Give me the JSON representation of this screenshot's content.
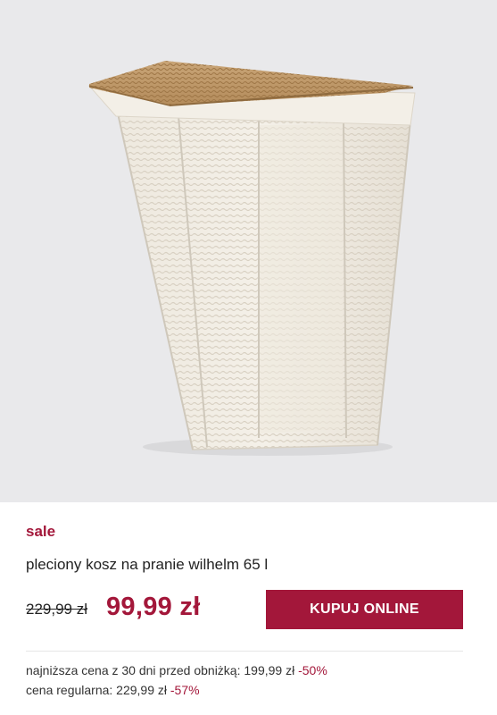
{
  "product": {
    "image_alt": "pleciony kosz na pranie wilhelm 65 l",
    "badge": "sale",
    "title": "pleciony kosz na pranie wilhelm 65 l",
    "old_price": "229,99 zł",
    "price": "99,99 zł",
    "buy_label": "KUPUJ ONLINE"
  },
  "price_info": {
    "lowest_label": "najniższa cena z 30 dni przed obniżką: 199,99 zł",
    "lowest_pct": "-50%",
    "regular_label": "cena regularna: 229,99 zł",
    "regular_pct": "-57%"
  },
  "colors": {
    "accent": "#a3173a",
    "image_background": "#e9e9eb"
  }
}
